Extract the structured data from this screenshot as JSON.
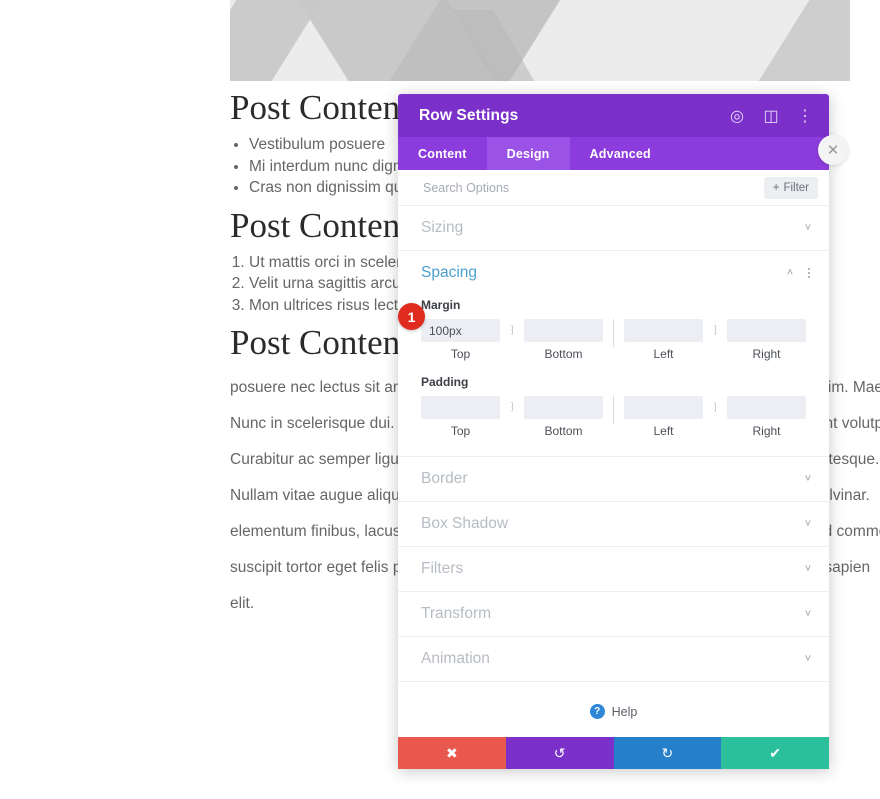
{
  "background_page": {
    "hero_image_alt": "placeholder-image",
    "headings": {
      "h1": "Post Content",
      "h2": "Post Content Heading",
      "h3": "Post Content Heading"
    },
    "bullet_list": [
      "Vestibulum posuere",
      "Mi interdum nunc dignissim",
      "Cras non dignissim quam"
    ],
    "numbered_list": [
      "Ut mattis orci in sceleris",
      "Velit urna sagittis arcu",
      "Mon ultrices risus lectus"
    ],
    "paragraph_lines": [
      "posuere nec lectus sit amet, sollicitudin rutrum lacus. Donec ornare consectetur dignissim. Maecenas.",
      "Nunc in scelerisque dui. Etiam eu odio ut libero mollis aliquet vel non nunc. Sed tincidunt volutpat.",
      "Curabitur ac semper ligula. Nulla facilisi. Vivamus vitae dolor at turpis fermentum pellentesque.",
      "Nullam vitae augue aliquet, efficitur risus eu, lacinia ex. Sed eget dui sed arcu mattis pulvinar.",
      "elementum finibus, lacus magna tincidunt nisl, quis vulputate ipsum justo vitae nulla sed commodo.",
      "suscipit tortor eget felis porttitor volutpat. Nulla porttitor accumsan tincidunt vestibulum sapien",
      "elit."
    ]
  },
  "modal": {
    "title": "Row Settings",
    "header_icons": [
      {
        "name": "focus-icon",
        "glyph": "◎"
      },
      {
        "name": "split-view-icon",
        "glyph": "◫"
      },
      {
        "name": "overflow-menu-icon",
        "glyph": "⋮"
      }
    ],
    "close_icon": "✕",
    "tabs": [
      {
        "label": "Content",
        "active": false
      },
      {
        "label": "Design",
        "active": true
      },
      {
        "label": "Advanced",
        "active": false
      }
    ],
    "search": {
      "value": "",
      "placeholder": "Search Options"
    },
    "filter_button": {
      "label": "Filter",
      "plus": "+"
    },
    "sections": [
      {
        "name": "Sizing",
        "open": false,
        "chevron": "˅"
      },
      {
        "name": "Spacing",
        "open": true,
        "chevron": "˄"
      },
      {
        "name": "Border",
        "open": false,
        "chevron": "˅"
      },
      {
        "name": "Box Shadow",
        "open": false,
        "chevron": "˅"
      },
      {
        "name": "Filters",
        "open": false,
        "chevron": "˅"
      },
      {
        "name": "Transform",
        "open": false,
        "chevron": "˅"
      },
      {
        "name": "Animation",
        "open": false,
        "chevron": "˅"
      }
    ],
    "spacing": {
      "margin": {
        "group_label": "Margin",
        "fields": [
          {
            "sub_label": "Top",
            "value": "100px",
            "placeholder": ""
          },
          {
            "sub_label": "Bottom",
            "value": "",
            "placeholder": ""
          },
          {
            "sub_label": "Left",
            "value": "",
            "placeholder": ""
          },
          {
            "sub_label": "Right",
            "value": "",
            "placeholder": ""
          }
        ],
        "link_icon": "⁆"
      },
      "padding": {
        "group_label": "Padding",
        "fields": [
          {
            "sub_label": "Top",
            "value": "",
            "placeholder": ""
          },
          {
            "sub_label": "Bottom",
            "value": "",
            "placeholder": ""
          },
          {
            "sub_label": "Left",
            "value": "",
            "placeholder": ""
          },
          {
            "sub_label": "Right",
            "value": "",
            "placeholder": ""
          }
        ],
        "link_icon": "⁆"
      }
    },
    "step_badge": "1",
    "help": {
      "label": "Help",
      "icon_glyph": "?"
    },
    "footer_buttons": [
      {
        "name": "cancel",
        "glyph": "✖",
        "color": "#e8584f"
      },
      {
        "name": "undo",
        "glyph": "↺",
        "color": "#7b30c9"
      },
      {
        "name": "redo",
        "glyph": "↻",
        "color": "#2580c9"
      },
      {
        "name": "save",
        "glyph": "✔",
        "color": "#2bbf9b"
      }
    ]
  },
  "colors": {
    "header_purple": "#7b30c9",
    "tabs_purple": "#8c3cdc",
    "active_tab_purple": "#9b52e6",
    "section_active_blue": "#4b9fd0",
    "badge_red": "#e02b20",
    "help_blue": "#2e86d6"
  }
}
